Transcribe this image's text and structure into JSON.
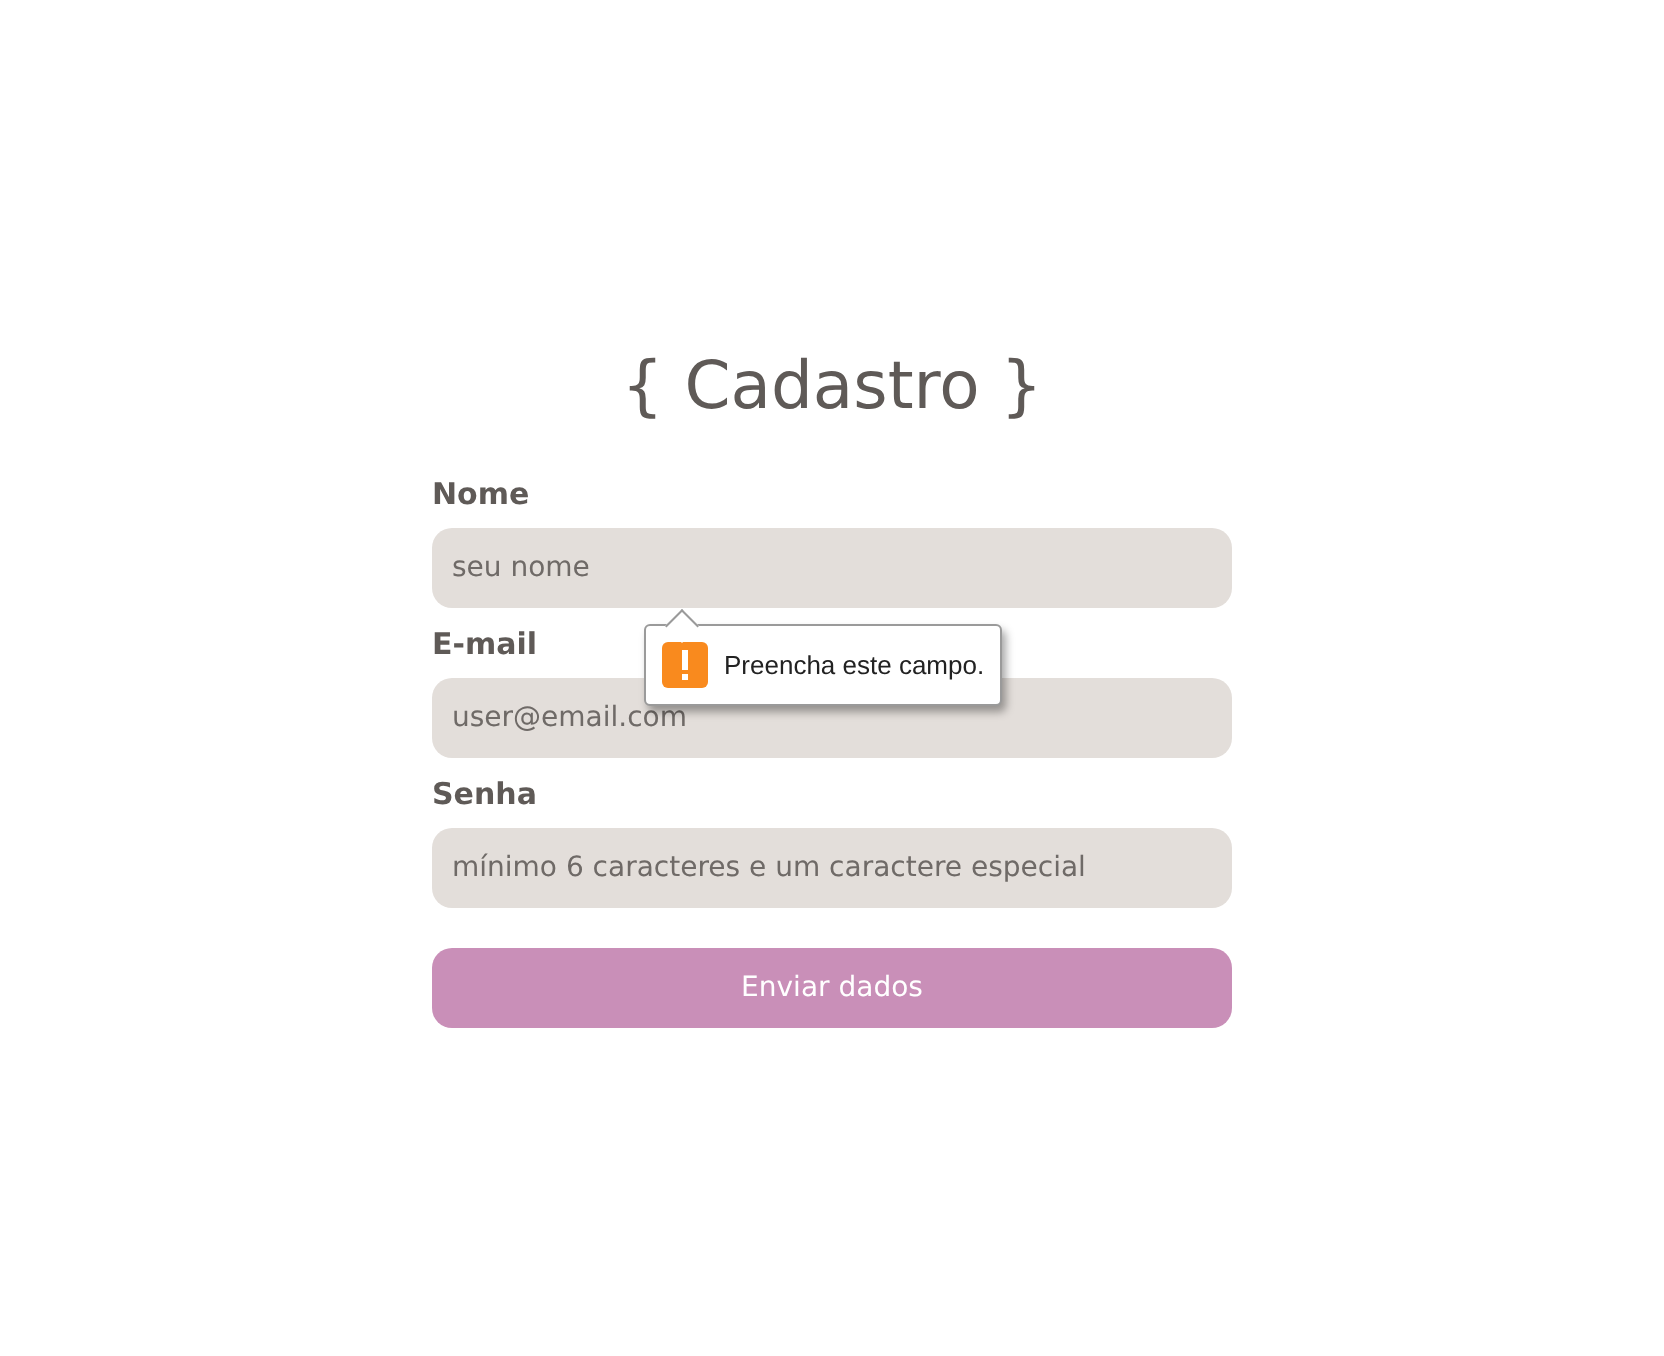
{
  "title": "{ Cadastro }",
  "fields": [
    {
      "label": "Nome",
      "placeholder": "seu nome",
      "tooltip": "Preencha este campo."
    },
    {
      "label": "E-mail",
      "placeholder": "user@email.com"
    },
    {
      "label": "Senha",
      "placeholder": "mínimo 6 caracteres e um caractere especial"
    }
  ],
  "button": "Enviar dados"
}
